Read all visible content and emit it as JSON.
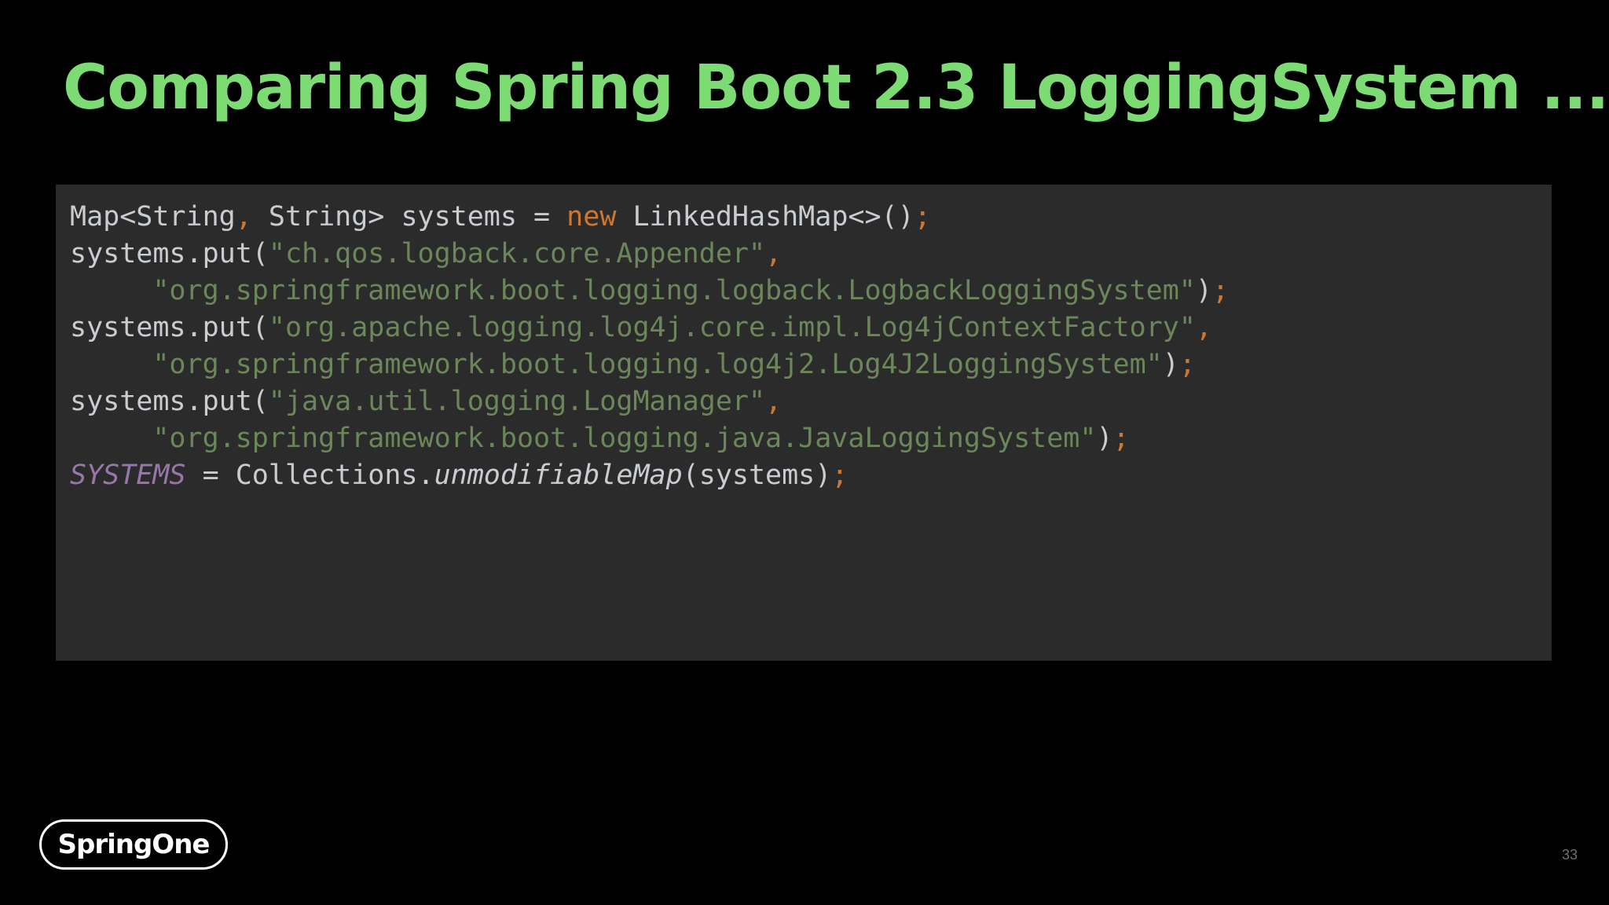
{
  "slide": {
    "title": "Comparing Spring Boot 2.3 LoggingSystem ...",
    "page_number": "33"
  },
  "brand": {
    "logo_text": "SpringOne"
  },
  "code": {
    "language": "java",
    "colors": {
      "background": "#2b2b2b",
      "plain": "#c9ccd0",
      "string": "#6b8759",
      "keyword": "#cc7832",
      "static_field": "#9876aa",
      "title": "#7ddb73"
    },
    "lines": [
      [
        {
          "t": "Map<String",
          "c": "plain"
        },
        {
          "t": ",",
          "c": "punct"
        },
        {
          "t": " String> systems = ",
          "c": "plain"
        },
        {
          "t": "new",
          "c": "kw"
        },
        {
          "t": " LinkedHashMap<>()",
          "c": "plain"
        },
        {
          "t": ";",
          "c": "punct"
        }
      ],
      [
        {
          "t": "systems.put(",
          "c": "plain"
        },
        {
          "t": "\"ch.qos.logback.core.Appender\"",
          "c": "str"
        },
        {
          "t": ",",
          "c": "punct"
        }
      ],
      [
        {
          "t": "     ",
          "c": "plain"
        },
        {
          "t": "\"org.springframework.boot.logging.logback.LogbackLoggingSystem\"",
          "c": "str"
        },
        {
          "t": ")",
          "c": "plain"
        },
        {
          "t": ";",
          "c": "punct"
        }
      ],
      [
        {
          "t": "systems.put(",
          "c": "plain"
        },
        {
          "t": "\"org.apache.logging.log4j.core.impl.Log4jContextFactory\"",
          "c": "str"
        },
        {
          "t": ",",
          "c": "punct"
        }
      ],
      [
        {
          "t": "     ",
          "c": "plain"
        },
        {
          "t": "\"org.springframework.boot.logging.log4j2.Log4J2LoggingSystem\"",
          "c": "str"
        },
        {
          "t": ")",
          "c": "plain"
        },
        {
          "t": ";",
          "c": "punct"
        }
      ],
      [
        {
          "t": "systems.put(",
          "c": "plain"
        },
        {
          "t": "\"java.util.logging.LogManager\"",
          "c": "str"
        },
        {
          "t": ",",
          "c": "punct"
        }
      ],
      [
        {
          "t": "     ",
          "c": "plain"
        },
        {
          "t": "\"org.springframework.boot.logging.java.JavaLoggingSystem\"",
          "c": "str"
        },
        {
          "t": ")",
          "c": "plain"
        },
        {
          "t": ";",
          "c": "punct"
        }
      ],
      [
        {
          "t": "SYSTEMS",
          "c": "static"
        },
        {
          "t": " = Collections.",
          "c": "plain"
        },
        {
          "t": "unmodifiableMap",
          "c": "method"
        },
        {
          "t": "(systems)",
          "c": "plain"
        },
        {
          "t": ";",
          "c": "punct"
        }
      ]
    ]
  }
}
